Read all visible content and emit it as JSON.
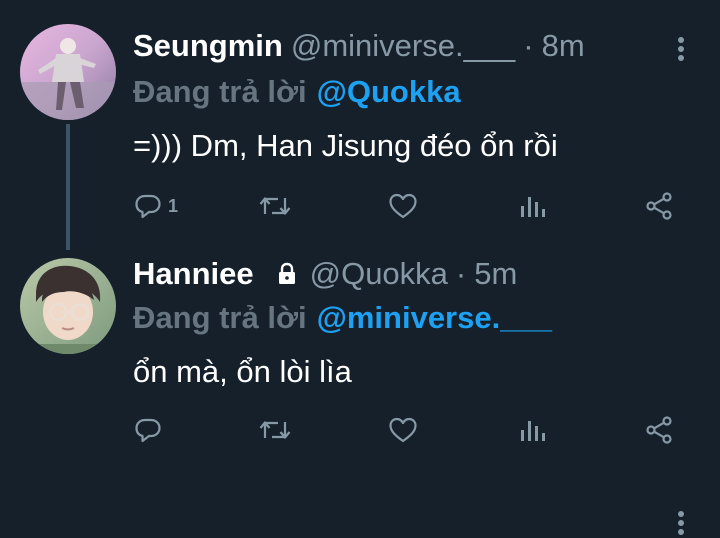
{
  "colors": {
    "background": "#15202b",
    "primary_text": "#ffffff",
    "secondary_text": "#8899a6",
    "link": "#1da1f2",
    "thread_line": "#3d5466"
  },
  "tweets": [
    {
      "display_name": "Seungmin",
      "handle": "@miniverse.___",
      "separator": "·",
      "time": "8m",
      "protected": false,
      "reply_prefix": "Đang trả lời",
      "reply_target": "@Quokka",
      "text": "=))) Dm, Han Jisung đéo ổn rồi",
      "reply_count": "1",
      "icons": [
        "reply-icon",
        "retweet-icon",
        "like-icon",
        "analytics-icon",
        "share-icon",
        "more-icon"
      ]
    },
    {
      "display_name": "Hanniee",
      "handle": "@Quokka",
      "separator": "·",
      "time": "5m",
      "protected": true,
      "reply_prefix": "Đang trả lời",
      "reply_target": "@miniverse.___",
      "text": "ổn mà, ổn lòi lìa",
      "reply_count": "",
      "icons": [
        "lock-icon",
        "reply-icon",
        "retweet-icon",
        "like-icon",
        "analytics-icon",
        "share-icon",
        "more-icon"
      ]
    }
  ]
}
